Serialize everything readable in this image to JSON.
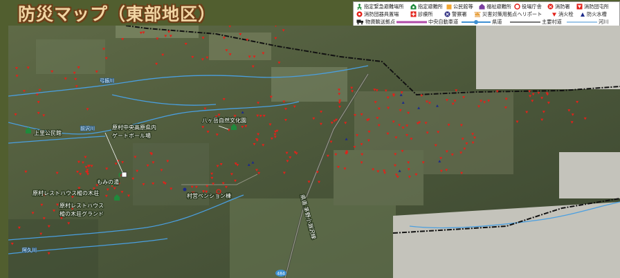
{
  "title": "防災マップ（東部地区）",
  "legend": {
    "items": [
      {
        "icon": "evacuation-area-icon",
        "label": "指定緊急避難場所"
      },
      {
        "icon": "evacuation-shelter-icon",
        "label": "指定避難所"
      },
      {
        "icon": "community-center-icon",
        "label": "公民館等"
      },
      {
        "icon": "welfare-shelter-icon",
        "label": "福祉避難所"
      },
      {
        "icon": "government-office-icon",
        "label": "役場庁舎"
      },
      {
        "icon": "fire-station-icon",
        "label": "消防署"
      },
      {
        "icon": "fire-brigade-shed-icon",
        "label": "消防団屯所"
      },
      {
        "icon": "fire-brigade-equipment-icon",
        "label": "消防団器具置場"
      },
      {
        "icon": "clinic-icon",
        "label": "診療所"
      },
      {
        "icon": "police-icon",
        "label": "警察署"
      },
      {
        "icon": "heliport-icon",
        "label": "災害対策用拠点ヘリポート"
      },
      {
        "icon": "fire-hydrant-icon",
        "label": "消火栓"
      },
      {
        "icon": "fire-cistern-icon",
        "label": "防火水槽"
      },
      {
        "icon": "supply-depot-icon",
        "label": "物資輸送拠点"
      },
      {
        "icon": "expressway-line",
        "label": "中央自動車道"
      },
      {
        "icon": "prefectural-road-line",
        "label": "県道"
      },
      {
        "icon": "main-road-line",
        "label": "主要村道"
      },
      {
        "icon": "river-line",
        "label": "河川"
      }
    ]
  },
  "places": [
    {
      "name": "上里公民館"
    },
    {
      "name": "原村中央高原県内\nゲートボール場"
    },
    {
      "name": "もみの湯"
    },
    {
      "name": "原村レストハウス樅の木荘"
    },
    {
      "name": "原村レストハウス\n樅の木荘グランド"
    },
    {
      "name": "八ヶ岳自然文化園"
    },
    {
      "name": "村営ペンション棟"
    }
  ],
  "rivers": [
    "弓振川",
    "前沢川",
    "阿久川"
  ],
  "road_labels": [
    "県道 茅野小淵沢線",
    "484"
  ],
  "colors": {
    "frame": "#515e2f",
    "title_text": "#f1d5a3",
    "title_outline": "#6e3f18",
    "hydrant": "#e32119",
    "cistern": "#1d2a8a",
    "river": "#4a9fe0",
    "boundary": "#111111",
    "shelter_green": "#1f8a3c"
  }
}
